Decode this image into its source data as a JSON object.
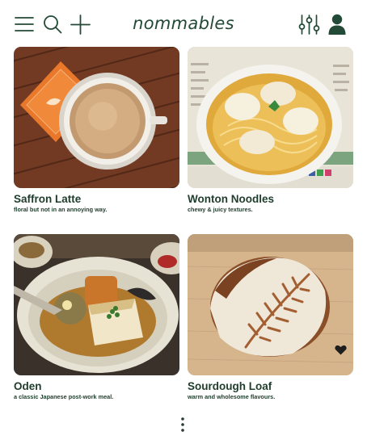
{
  "app": {
    "title": "nommables"
  },
  "header": {
    "menu_icon": "hamburger-menu-icon",
    "search_icon": "search-icon",
    "add_icon": "plus-icon",
    "filter_icon": "sliders-icon",
    "profile_icon": "user-icon"
  },
  "colors": {
    "accent": "#234a36",
    "text": "#1f3d2c",
    "background": "#ffffff"
  },
  "cards": [
    {
      "title": "Saffron Latte",
      "subtitle": "floral but not in an annoying way."
    },
    {
      "title": "Wonton Noodles",
      "subtitle": "chewy & juicy textures."
    },
    {
      "title": "Oden",
      "subtitle": "a classic Japanese post-work meal."
    },
    {
      "title": "Sourdough Loaf",
      "subtitle": "warm and wholesome flavours.",
      "favorited": true
    }
  ],
  "footer": {
    "more_icon": "vertical-ellipsis-icon"
  }
}
